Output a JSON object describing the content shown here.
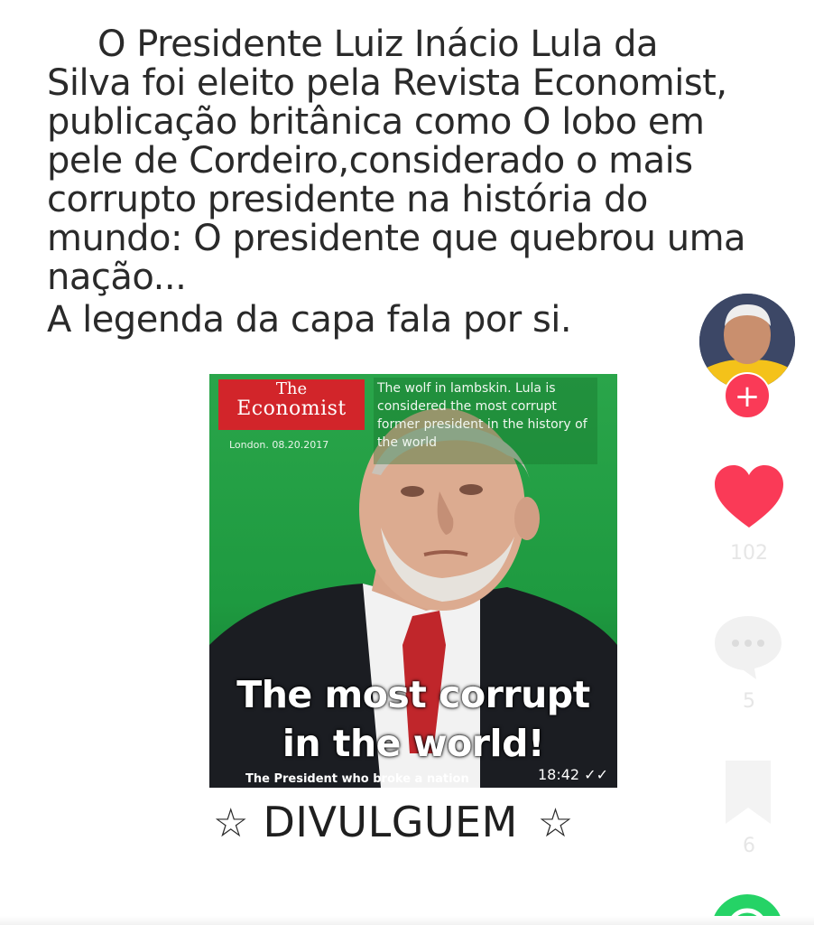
{
  "post": {
    "lines": [
      "O Presidente Luiz Inácio Lula da",
      "Silva foi eleito pela Revista Economist,",
      "publicação britânica como O lobo em",
      "pele de Cordeiro,considerado o mais",
      "corrupto presidente na história do",
      "mundo: O presidente que quebrou uma",
      "nação...",
      "A legenda da capa fala por si."
    ]
  },
  "cover": {
    "logo_the": "The",
    "logo_name": "Economist",
    "date": "London. 08.20.2017",
    "blurb": "The wolf in lambskin. Lula is considered the most corrupt former president in the history of the world",
    "headline_1": "The most corrupt",
    "headline_2": "in the world!",
    "subhead": "The President who broke a nation",
    "timestamp": "18:42 ✓✓"
  },
  "footer": {
    "star_left": "☆",
    "text": "DIVULGUEM",
    "star_right": "☆"
  },
  "rail": {
    "follow_symbol": "+",
    "likes": "102",
    "comments": "5",
    "bookmarks": "6"
  },
  "icons": {
    "avatar": "avatar",
    "follow": "plus-icon",
    "like": "heart-icon",
    "comment": "comment-bubble-icon",
    "bookmark": "bookmark-icon",
    "share": "whatsapp-icon"
  },
  "colors": {
    "like": "#fa3a57",
    "follow": "#fa3a57",
    "economist_red": "#d2252a",
    "cover_green": "#27a047",
    "whatsapp": "#25d366"
  }
}
